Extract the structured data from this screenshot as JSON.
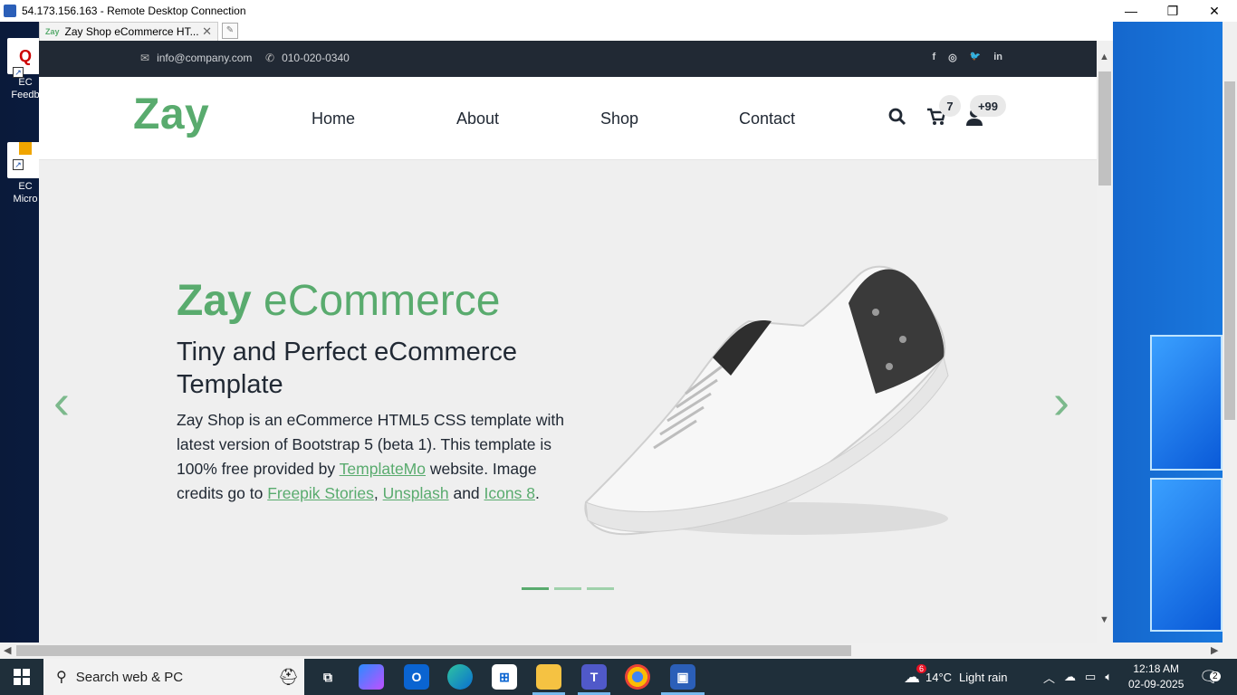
{
  "rdc": {
    "title": "54.173.156.163 - Remote Desktop Connection",
    "min": "—",
    "max": "❐",
    "close": "✕"
  },
  "desktop": {
    "icons": [
      {
        "label": "EC\nFeedb"
      },
      {
        "label": "EC\nMicro"
      }
    ]
  },
  "browser": {
    "tab_favicon": "Zay",
    "tab_title": "Zay Shop eCommerce HT...",
    "tab_close": "✕"
  },
  "site": {
    "email": "info@company.com",
    "phone": "010-020-0340",
    "social": [
      "f",
      "◎",
      "🐦",
      "in"
    ],
    "logo": "Zay",
    "nav": [
      "Home",
      "About",
      "Shop",
      "Contact"
    ],
    "cart_count": "7",
    "user_count": "+99",
    "hero": {
      "title_bold": "Zay",
      "title_light": " eCommerce",
      "subtitle": "Tiny and Perfect eCommerce Template",
      "p1": "Zay Shop is an eCommerce HTML5 CSS template with latest version of Bootstrap 5 (beta 1). This template is 100% free provided by ",
      "link1": "TemplateMo",
      "p2": " website. Image credits go to ",
      "link2": "Freepik Stories",
      "sep": ", ",
      "link3": "Unsplash",
      "and": " and ",
      "link4": "Icons 8",
      "end": "."
    },
    "prev": "‹",
    "next": "›",
    "carousel_active_index": 0,
    "carousel_count": 3
  },
  "taskbar": {
    "search_placeholder": "Search web & PC",
    "weather_temp": "14°C",
    "weather_text": "Light rain",
    "weather_badge": "6",
    "time": "12:18 AM",
    "date": "02-09-2025",
    "notif_count": "2"
  }
}
